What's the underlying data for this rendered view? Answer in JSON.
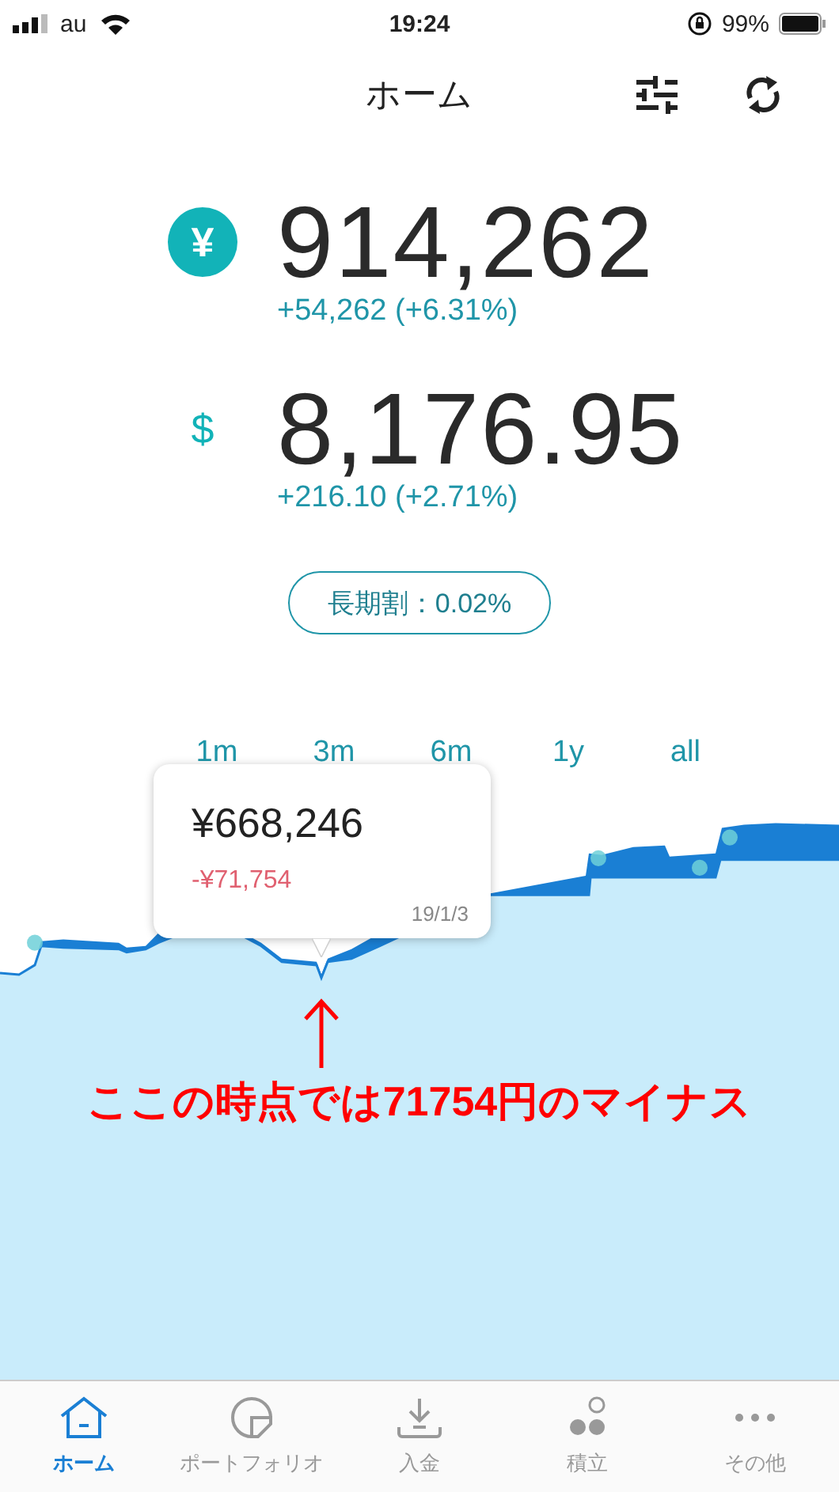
{
  "status_bar": {
    "carrier": "au",
    "time": "19:24",
    "battery": "99%"
  },
  "header": {
    "title": "ホーム"
  },
  "balances": [
    {
      "kind": "yen",
      "symbol": "¥",
      "amount": "914,262",
      "change": "+54,262 (+6.31%)"
    },
    {
      "kind": "dollar",
      "symbol": "$",
      "amount": "8,176.95",
      "change": "+216.10 (+2.71%)"
    }
  ],
  "discount_badge": "長期割：0.02%",
  "ranges": [
    {
      "label": "1m",
      "selected": false
    },
    {
      "label": "3m",
      "selected": false
    },
    {
      "label": "6m",
      "selected": false
    },
    {
      "label": "1y",
      "selected": false
    },
    {
      "label": "all",
      "selected": false
    }
  ],
  "tooltip": {
    "value": "¥668,246",
    "change": "-¥71,754",
    "date": "19/1/3"
  },
  "annotation": {
    "text": "ここの時点では71754円のマイナス"
  },
  "tabs": [
    {
      "label": "ホーム",
      "kind": "home",
      "selected": true
    },
    {
      "label": "ポートフォリオ",
      "kind": "portfolio",
      "selected": false
    },
    {
      "label": "入金",
      "kind": "deposit",
      "selected": false
    },
    {
      "label": "積立",
      "kind": "savings",
      "selected": false
    },
    {
      "label": "その他",
      "kind": "more",
      "selected": false
    }
  ]
}
